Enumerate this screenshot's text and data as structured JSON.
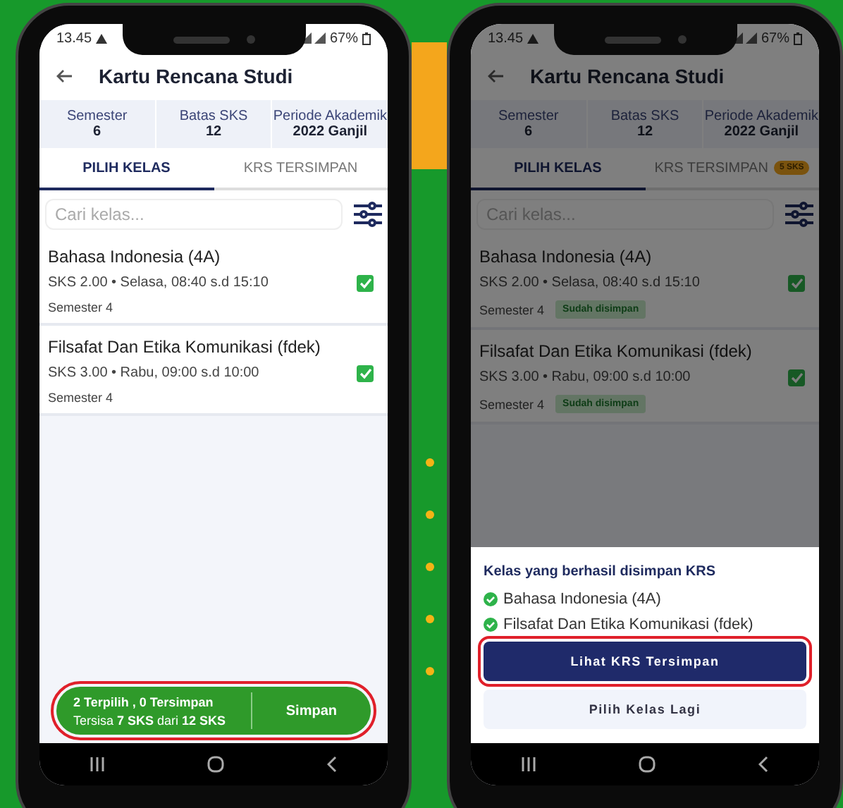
{
  "phones": [
    {
      "status_bar": {
        "time": "13.45",
        "battery": "67%"
      },
      "header": {
        "title": "Kartu Rencana Studi"
      },
      "summary": [
        {
          "label": "Semester",
          "value": "6"
        },
        {
          "label": "Batas SKS",
          "value": "12"
        },
        {
          "label": "Periode Akademik",
          "value": "2022 Ganjil"
        }
      ],
      "tabs": [
        {
          "label": "PILIH KELAS",
          "selected": true
        },
        {
          "label": "KRS TERSIMPAN",
          "selected": false
        }
      ],
      "search": {
        "placeholder": "Cari kelas..."
      },
      "classes": [
        {
          "name": "Bahasa Indonesia (4A)",
          "detail": "SKS 2.00 • Selasa, 08:40 s.d 15:10",
          "semester": "Semester 4",
          "checked": true
        },
        {
          "name": "Filsafat Dan Etika Komunikasi (fdek)",
          "detail": "SKS 3.00 • Rabu, 09:00 s.d 10:00",
          "semester": "Semester 4",
          "checked": true
        }
      ],
      "action_bar": {
        "summary": "2 Terpilih ,  0 Tersimpan",
        "remaining": "Tersisa **7 SKS** dari **12 SKS**",
        "button": "Simpan",
        "highlighted": true
      }
    },
    {
      "status_bar": {
        "time": "13.45",
        "battery": "67%"
      },
      "header": {
        "title": "Kartu Rencana Studi"
      },
      "summary": [
        {
          "label": "Semester",
          "value": "6"
        },
        {
          "label": "Batas SKS",
          "value": "12"
        },
        {
          "label": "Periode Akademik",
          "value": "2022 Ganjil"
        }
      ],
      "tabs": [
        {
          "label": "PILIH KELAS",
          "selected": true
        },
        {
          "label": "KRS TERSIMPAN",
          "selected": false,
          "badge": "5 SKS"
        }
      ],
      "search": {
        "placeholder": "Cari kelas..."
      },
      "classes": [
        {
          "name": "Bahasa Indonesia (4A)",
          "detail": "SKS 2.00 • Selasa, 08:40 s.d 15:10",
          "semester": "Semester 4",
          "checked": true,
          "status": "Sudah disimpan"
        },
        {
          "name": "Filsafat Dan Etika Komunikasi (fdek)",
          "detail": "SKS 3.00 • Rabu, 09:00 s.d 10:00",
          "semester": "Semester 4",
          "checked": true,
          "status": "Sudah disimpan"
        }
      ],
      "sheet": {
        "title": "Kelas yang berhasil disimpan KRS",
        "items": [
          "Bahasa Indonesia (4A)",
          "Filsafat Dan Etika Komunikasi (fdek)"
        ],
        "buttons": [
          {
            "label": "Lihat KRS Tersimpan",
            "kind": "primary",
            "highlighted": true
          },
          {
            "label": "Pilih Kelas Lagi",
            "kind": "secondary",
            "highlighted": false
          }
        ]
      }
    }
  ]
}
